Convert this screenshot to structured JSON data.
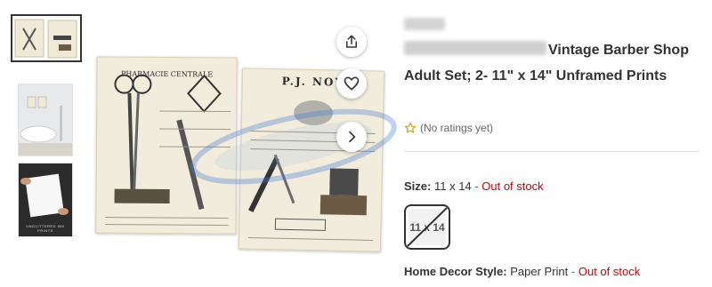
{
  "gallery": {
    "thumbnails": [
      {
        "name": "thumb-prints-pair"
      },
      {
        "name": "thumb-bathroom-scene"
      },
      {
        "name": "thumb-hand-holding-print",
        "caption": "UNGLITTERED INK PRINTS"
      }
    ],
    "prints": {
      "left_title": "PHARMACIE CENTRALE",
      "right_title": "P.J. NOY"
    },
    "icons": {
      "share": "share-icon",
      "favorite": "heart-icon",
      "next": "chevron-right-icon"
    }
  },
  "product": {
    "title": "Vintage Barber Shop Adult Set; 2- 11\" x 14\" Unframed Prints",
    "rating_text": "(No ratings yet)",
    "size": {
      "label": "Size:",
      "value": "11 x 14",
      "separator": "-",
      "status": "Out of stock",
      "swatch_label": "11 x 14"
    },
    "home_decor_style": {
      "label": "Home Decor Style:",
      "value": "Paper Print",
      "separator": "-",
      "status": "Out of stock"
    }
  },
  "colors": {
    "out_of_stock": "#cc0000",
    "star": "#c9a227",
    "text": "#333333"
  }
}
